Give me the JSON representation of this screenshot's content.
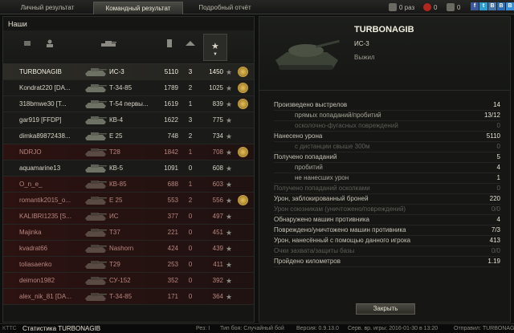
{
  "tabs": [
    "Личный результат",
    "Командный результат",
    "Подробный отчёт"
  ],
  "top_stats": {
    "views": "0 раз",
    "likes": "0",
    "comments": "0"
  },
  "social": [
    "f",
    "t",
    "B",
    "B",
    "B"
  ],
  "team": {
    "title": "Наши",
    "rows": [
      {
        "player": "TURBONAGIB",
        "tank": "ИС-3",
        "damage": "5110",
        "kills": "3",
        "xp": "1450",
        "state": "me",
        "medal": true
      },
      {
        "player": "Kondrat220 [DA...",
        "tank": "Т-34-85",
        "damage": "1789",
        "kills": "2",
        "xp": "1025",
        "state": "alive",
        "medal": true
      },
      {
        "player": "318bmwe30 [T...",
        "tank": "Т-54 первы...",
        "damage": "1619",
        "kills": "1",
        "xp": "839",
        "state": "alive",
        "medal": true
      },
      {
        "player": "gar919 [FFDP]",
        "tank": "КВ-4",
        "damage": "1622",
        "kills": "3",
        "xp": "775",
        "state": "alive",
        "medal": false
      },
      {
        "player": "dimka89872438...",
        "tank": "E 25",
        "damage": "748",
        "kills": "2",
        "xp": "734",
        "state": "alive",
        "medal": false
      },
      {
        "player": "NDRJO",
        "tank": "T28",
        "damage": "1842",
        "kills": "1",
        "xp": "708",
        "state": "dead",
        "medal": true
      },
      {
        "player": "aquamarine13",
        "tank": "КВ-5",
        "damage": "1091",
        "kills": "0",
        "xp": "608",
        "state": "alive",
        "medal": false
      },
      {
        "player": "O_n_e_",
        "tank": "КВ-85",
        "damage": "688",
        "kills": "1",
        "xp": "603",
        "state": "dead",
        "medal": false
      },
      {
        "player": "romantik2015_o...",
        "tank": "E 25",
        "damage": "553",
        "kills": "2",
        "xp": "556",
        "state": "dead",
        "medal": true
      },
      {
        "player": "KALIBRI1235 [S...",
        "tank": "ИС",
        "damage": "377",
        "kills": "0",
        "xp": "497",
        "state": "dead",
        "medal": false
      },
      {
        "player": "Majinka",
        "tank": "T37",
        "damage": "221",
        "kills": "0",
        "xp": "451",
        "state": "dead",
        "medal": false
      },
      {
        "player": "kvadrat66",
        "tank": "Nashorn",
        "damage": "424",
        "kills": "0",
        "xp": "439",
        "state": "dead",
        "medal": false
      },
      {
        "player": "toliasaenko",
        "tank": "T29",
        "damage": "253",
        "kills": "0",
        "xp": "411",
        "state": "dead",
        "medal": false
      },
      {
        "player": "deimon1982",
        "tank": "СУ-152",
        "damage": "352",
        "kills": "0",
        "xp": "392",
        "state": "dead",
        "medal": false
      },
      {
        "player": "alex_nik_81 [DA...",
        "tank": "Т-34-85",
        "damage": "171",
        "kills": "0",
        "xp": "364",
        "state": "dead",
        "medal": false
      }
    ]
  },
  "detail": {
    "player": "TURBONAGIB",
    "tank": "ИС-3",
    "status": "Выжил",
    "stats": [
      {
        "label": "Произведено выстрелов",
        "value": "14",
        "sub": false,
        "dim": false
      },
      {
        "label": "прямых попаданий/пробитий",
        "value": "13/12",
        "sub": true,
        "dim": false
      },
      {
        "label": "осколочно-фугасных повреждений",
        "value": "0",
        "sub": true,
        "dim": true
      },
      {
        "label": "Нанесено урона",
        "value": "5110",
        "sub": false,
        "dim": false
      },
      {
        "label": "с дистанции свыше 300м",
        "value": "0",
        "sub": true,
        "dim": true
      },
      {
        "label": "Получено попаданий",
        "value": "5",
        "sub": false,
        "dim": false
      },
      {
        "label": "пробитий",
        "value": "4",
        "sub": true,
        "dim": false
      },
      {
        "label": "не нанесших урон",
        "value": "1",
        "sub": true,
        "dim": false
      },
      {
        "label": "Получено попаданий осколками",
        "value": "0",
        "sub": false,
        "dim": true
      },
      {
        "label": "Урон, заблокированный броней",
        "value": "220",
        "sub": false,
        "dim": false
      },
      {
        "label": "Урон союзникам (уничтожено/повреждений)",
        "value": "0/0",
        "sub": false,
        "dim": true
      },
      {
        "label": "Обнаружено машин противника",
        "value": "4",
        "sub": false,
        "dim": false
      },
      {
        "label": "Повреждено/уничтожено машин противника",
        "value": "7/3",
        "sub": false,
        "dim": false
      },
      {
        "label": "Урон, нанесённый с помощью данного игрока",
        "value": "413",
        "sub": false,
        "dim": false
      },
      {
        "label": "Очки захвата/защиты базы",
        "value": "0/0",
        "sub": false,
        "dim": true
      },
      {
        "label": "Пройдено километров",
        "value": "1.19",
        "sub": false,
        "dim": false
      }
    ],
    "close_label": "Закрыть"
  },
  "footer": {
    "brand": "КТТС",
    "title": "Статистика TURBONAGIB",
    "res": "Рез: I",
    "battle_type": "Тип боя: Случайный бой",
    "version": "Версия: 0.9.13.0",
    "date": "Серв. вр. игры: 2016-01-30 в 13:20",
    "sender": "Отправил: TURBONAGIB"
  },
  "colors": {
    "accent": "#c9a041",
    "dead_row": "#2c1211",
    "social_fb": "#3b5998",
    "social_tw": "#2a9fd6"
  }
}
